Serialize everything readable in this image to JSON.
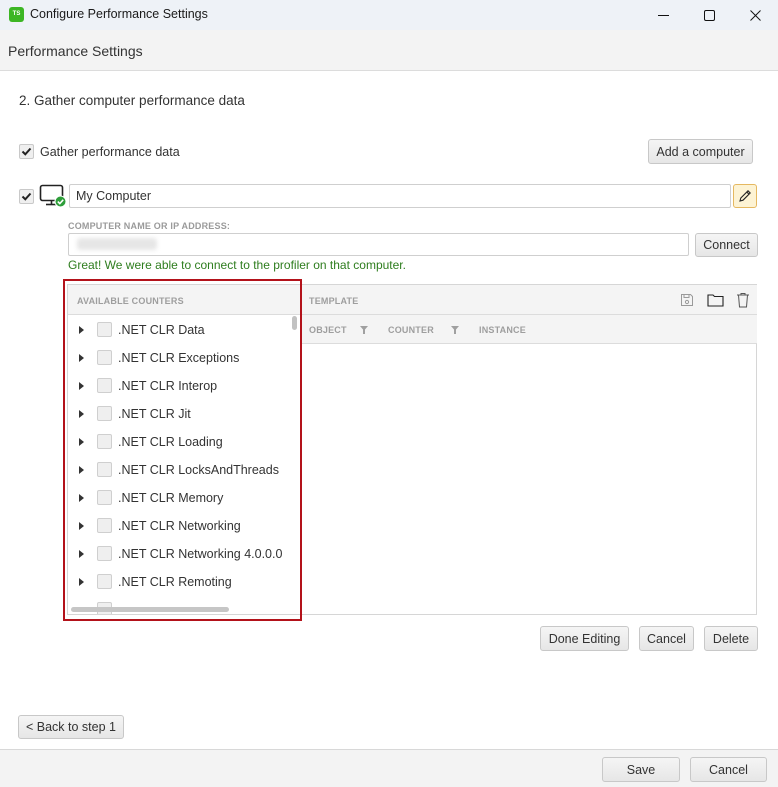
{
  "window": {
    "app_icon_text": "TS",
    "title": "Configure Performance Settings",
    "controls": [
      "minimize-icon",
      "maximize-icon",
      "close-icon"
    ]
  },
  "header": {
    "title": "Performance Settings"
  },
  "step": {
    "title": "2. Gather computer performance data"
  },
  "gather": {
    "checked": true,
    "label": "Gather performance data",
    "add_computer_label": "Add a computer"
  },
  "computer": {
    "checked": true,
    "icon": "monitor-connected-icon",
    "name_value": "My Computer",
    "edit_icon": "pencil-icon",
    "address_label": "COMPUTER NAME OR IP ADDRESS:",
    "address_value": "",
    "connect_label": "Connect",
    "status_message": "Great! We were able to connect to the profiler on that computer.",
    "status_color": "#2e7d1e"
  },
  "counters": {
    "header": "AVAILABLE COUNTERS",
    "items": [
      {
        "label": ".NET CLR Data",
        "checked": false
      },
      {
        "label": ".NET CLR Exceptions",
        "checked": false
      },
      {
        "label": ".NET CLR Interop",
        "checked": false
      },
      {
        "label": ".NET CLR Jit",
        "checked": false
      },
      {
        "label": ".NET CLR Loading",
        "checked": false
      },
      {
        "label": ".NET CLR LocksAndThreads",
        "checked": false
      },
      {
        "label": ".NET CLR Memory",
        "checked": false
      },
      {
        "label": ".NET CLR Networking",
        "checked": false
      },
      {
        "label": ".NET CLR Networking 4.0.0.0",
        "checked": false
      },
      {
        "label": ".NET CLR Remoting",
        "checked": false
      }
    ]
  },
  "template": {
    "header": "TEMPLATE",
    "tools": [
      "save-icon",
      "folder-icon",
      "trash-icon"
    ],
    "columns": [
      {
        "label": "OBJECT",
        "filter": true
      },
      {
        "label": "COUNTER",
        "filter": true
      },
      {
        "label": "INSTANCE",
        "filter": false
      }
    ],
    "rows": []
  },
  "editing": {
    "done_label": "Done Editing",
    "cancel_label": "Cancel",
    "delete_label": "Delete"
  },
  "nav": {
    "back_label": "< Back to step 1"
  },
  "footer": {
    "save_label": "Save",
    "cancel_label": "Cancel"
  },
  "colors": {
    "highlight": "#b3121a",
    "edit_button_bg": "#fdf3d4",
    "app_icon": "#3cb624"
  }
}
